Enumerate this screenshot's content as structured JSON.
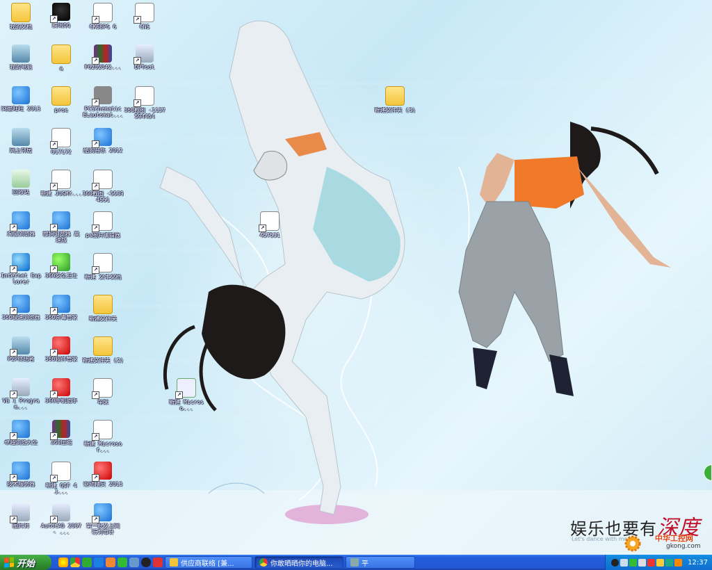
{
  "desktop": {
    "icons": [
      {
        "label": "我的文档",
        "icon": "folder-icon"
      },
      {
        "label": "我的电脑",
        "icon": "computer-icon"
      },
      {
        "label": "阿里旺旺 2013",
        "icon": "aliwangwang-icon"
      },
      {
        "label": "网上邻居",
        "icon": "network-icon"
      },
      {
        "label": "回收站",
        "icon": "recycle-bin-icon"
      },
      {
        "label": "淘宝浏览器",
        "icon": "browser-icon"
      },
      {
        "label": "Internet Explorer",
        "icon": "ie-icon"
      },
      {
        "label": "360极速浏览器",
        "icon": "browser-icon"
      },
      {
        "label": "P2P终结者",
        "icon": "network-icon"
      },
      {
        "label": "VB 1 Program...",
        "icon": "program-icon"
      },
      {
        "label": "卓越浏览大全",
        "icon": "k-icon"
      },
      {
        "label": "技术服务器",
        "icon": "server-icon"
      },
      {
        "label": "图片师",
        "icon": "tool-icon"
      },
      {
        "label": "腾讯QQ",
        "icon": "qq-icon"
      },
      {
        "label": "a",
        "icon": "folder-icon"
      },
      {
        "label": "proe",
        "icon": "folder-icon"
      },
      {
        "label": "017172",
        "icon": "document-icon"
      },
      {
        "label": "新建 JUSMY...",
        "icon": "document-icon"
      },
      {
        "label": "搜狗浏览器 高速版",
        "icon": "sogou-icon"
      },
      {
        "label": "360安全卫士",
        "icon": "shield-icon"
      },
      {
        "label": "360杀毒管家",
        "icon": "antivirus-icon"
      },
      {
        "label": "360软件管家",
        "icon": "software-icon"
      },
      {
        "label": "360手机助手",
        "icon": "phone-icon"
      },
      {
        "label": "360压缩",
        "icon": "archive-icon"
      },
      {
        "label": "新建 QIF 4J...",
        "icon": "document-icon"
      },
      {
        "label": "AutoCAD 2007 - ...",
        "icon": "autocad-icon"
      },
      {
        "label": "CKSBPG 6",
        "icon": "document-icon"
      },
      {
        "label": "F0202042...",
        "icon": "archive-icon"
      },
      {
        "label": "PCSchematic ELautomat...",
        "icon": "elephant-icon"
      },
      {
        "label": "酷狗音乐 2012",
        "icon": "k-icon"
      },
      {
        "label": "360截图 -55394551",
        "icon": "document-icon"
      },
      {
        "label": "ps图片编辑器",
        "icon": "document-icon"
      },
      {
        "label": "新建 文本文档",
        "icon": "text-file-icon"
      },
      {
        "label": "新建文件夹",
        "icon": "folder-icon"
      },
      {
        "label": "新建文件夹 (2)",
        "icon": "folder-icon"
      },
      {
        "label": "车床",
        "icon": "document-icon"
      },
      {
        "label": "新建 Microsof...",
        "icon": "word-doc-icon"
      },
      {
        "label": "驱动精灵 2013",
        "icon": "driver-icon"
      },
      {
        "label": "第一批次上网 行为审计",
        "icon": "network-audit-icon"
      },
      {
        "label": "CNS",
        "icon": "document-icon"
      },
      {
        "label": "DPTool",
        "icon": "tool-icon"
      },
      {
        "label": "360截图 -1137594454",
        "icon": "document-icon"
      },
      {
        "label": "457531",
        "icon": "document-icon"
      },
      {
        "label": "新建 Microso...",
        "icon": "excel-doc-icon"
      },
      {
        "label": "新建文件夹 (3)",
        "icon": "folder-icon"
      }
    ],
    "brand_text": "娱乐也要有",
    "brand_highlight": "深度",
    "brand_en": "Let's dance with me",
    "watermark_cn": "中华工控网",
    "watermark_url": "gkong.com"
  },
  "taskbar": {
    "start_label": "开始",
    "tasks": [
      {
        "label": "供应商联络 [兼...",
        "active": false
      },
      {
        "label": "你敢晒晒你的电脑...",
        "active": true
      },
      {
        "label": "平",
        "active": false
      }
    ],
    "clock": "12:37"
  }
}
